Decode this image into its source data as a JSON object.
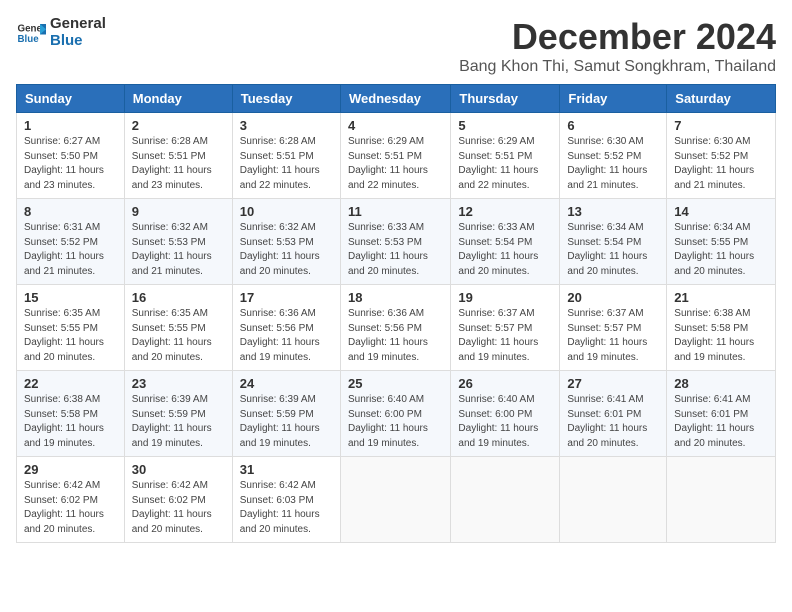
{
  "logo": {
    "text_general": "General",
    "text_blue": "Blue"
  },
  "title": {
    "month": "December 2024",
    "location": "Bang Khon Thi, Samut Songkhram, Thailand"
  },
  "weekdays": [
    "Sunday",
    "Monday",
    "Tuesday",
    "Wednesday",
    "Thursday",
    "Friday",
    "Saturday"
  ],
  "weeks": [
    [
      {
        "day": "1",
        "info": "Sunrise: 6:27 AM\nSunset: 5:50 PM\nDaylight: 11 hours\nand 23 minutes."
      },
      {
        "day": "2",
        "info": "Sunrise: 6:28 AM\nSunset: 5:51 PM\nDaylight: 11 hours\nand 23 minutes."
      },
      {
        "day": "3",
        "info": "Sunrise: 6:28 AM\nSunset: 5:51 PM\nDaylight: 11 hours\nand 22 minutes."
      },
      {
        "day": "4",
        "info": "Sunrise: 6:29 AM\nSunset: 5:51 PM\nDaylight: 11 hours\nand 22 minutes."
      },
      {
        "day": "5",
        "info": "Sunrise: 6:29 AM\nSunset: 5:51 PM\nDaylight: 11 hours\nand 22 minutes."
      },
      {
        "day": "6",
        "info": "Sunrise: 6:30 AM\nSunset: 5:52 PM\nDaylight: 11 hours\nand 21 minutes."
      },
      {
        "day": "7",
        "info": "Sunrise: 6:30 AM\nSunset: 5:52 PM\nDaylight: 11 hours\nand 21 minutes."
      }
    ],
    [
      {
        "day": "8",
        "info": "Sunrise: 6:31 AM\nSunset: 5:52 PM\nDaylight: 11 hours\nand 21 minutes."
      },
      {
        "day": "9",
        "info": "Sunrise: 6:32 AM\nSunset: 5:53 PM\nDaylight: 11 hours\nand 21 minutes."
      },
      {
        "day": "10",
        "info": "Sunrise: 6:32 AM\nSunset: 5:53 PM\nDaylight: 11 hours\nand 20 minutes."
      },
      {
        "day": "11",
        "info": "Sunrise: 6:33 AM\nSunset: 5:53 PM\nDaylight: 11 hours\nand 20 minutes."
      },
      {
        "day": "12",
        "info": "Sunrise: 6:33 AM\nSunset: 5:54 PM\nDaylight: 11 hours\nand 20 minutes."
      },
      {
        "day": "13",
        "info": "Sunrise: 6:34 AM\nSunset: 5:54 PM\nDaylight: 11 hours\nand 20 minutes."
      },
      {
        "day": "14",
        "info": "Sunrise: 6:34 AM\nSunset: 5:55 PM\nDaylight: 11 hours\nand 20 minutes."
      }
    ],
    [
      {
        "day": "15",
        "info": "Sunrise: 6:35 AM\nSunset: 5:55 PM\nDaylight: 11 hours\nand 20 minutes."
      },
      {
        "day": "16",
        "info": "Sunrise: 6:35 AM\nSunset: 5:55 PM\nDaylight: 11 hours\nand 20 minutes."
      },
      {
        "day": "17",
        "info": "Sunrise: 6:36 AM\nSunset: 5:56 PM\nDaylight: 11 hours\nand 19 minutes."
      },
      {
        "day": "18",
        "info": "Sunrise: 6:36 AM\nSunset: 5:56 PM\nDaylight: 11 hours\nand 19 minutes."
      },
      {
        "day": "19",
        "info": "Sunrise: 6:37 AM\nSunset: 5:57 PM\nDaylight: 11 hours\nand 19 minutes."
      },
      {
        "day": "20",
        "info": "Sunrise: 6:37 AM\nSunset: 5:57 PM\nDaylight: 11 hours\nand 19 minutes."
      },
      {
        "day": "21",
        "info": "Sunrise: 6:38 AM\nSunset: 5:58 PM\nDaylight: 11 hours\nand 19 minutes."
      }
    ],
    [
      {
        "day": "22",
        "info": "Sunrise: 6:38 AM\nSunset: 5:58 PM\nDaylight: 11 hours\nand 19 minutes."
      },
      {
        "day": "23",
        "info": "Sunrise: 6:39 AM\nSunset: 5:59 PM\nDaylight: 11 hours\nand 19 minutes."
      },
      {
        "day": "24",
        "info": "Sunrise: 6:39 AM\nSunset: 5:59 PM\nDaylight: 11 hours\nand 19 minutes."
      },
      {
        "day": "25",
        "info": "Sunrise: 6:40 AM\nSunset: 6:00 PM\nDaylight: 11 hours\nand 19 minutes."
      },
      {
        "day": "26",
        "info": "Sunrise: 6:40 AM\nSunset: 6:00 PM\nDaylight: 11 hours\nand 19 minutes."
      },
      {
        "day": "27",
        "info": "Sunrise: 6:41 AM\nSunset: 6:01 PM\nDaylight: 11 hours\nand 20 minutes."
      },
      {
        "day": "28",
        "info": "Sunrise: 6:41 AM\nSunset: 6:01 PM\nDaylight: 11 hours\nand 20 minutes."
      }
    ],
    [
      {
        "day": "29",
        "info": "Sunrise: 6:42 AM\nSunset: 6:02 PM\nDaylight: 11 hours\nand 20 minutes."
      },
      {
        "day": "30",
        "info": "Sunrise: 6:42 AM\nSunset: 6:02 PM\nDaylight: 11 hours\nand 20 minutes."
      },
      {
        "day": "31",
        "info": "Sunrise: 6:42 AM\nSunset: 6:03 PM\nDaylight: 11 hours\nand 20 minutes."
      },
      {
        "day": "",
        "info": ""
      },
      {
        "day": "",
        "info": ""
      },
      {
        "day": "",
        "info": ""
      },
      {
        "day": "",
        "info": ""
      }
    ]
  ]
}
